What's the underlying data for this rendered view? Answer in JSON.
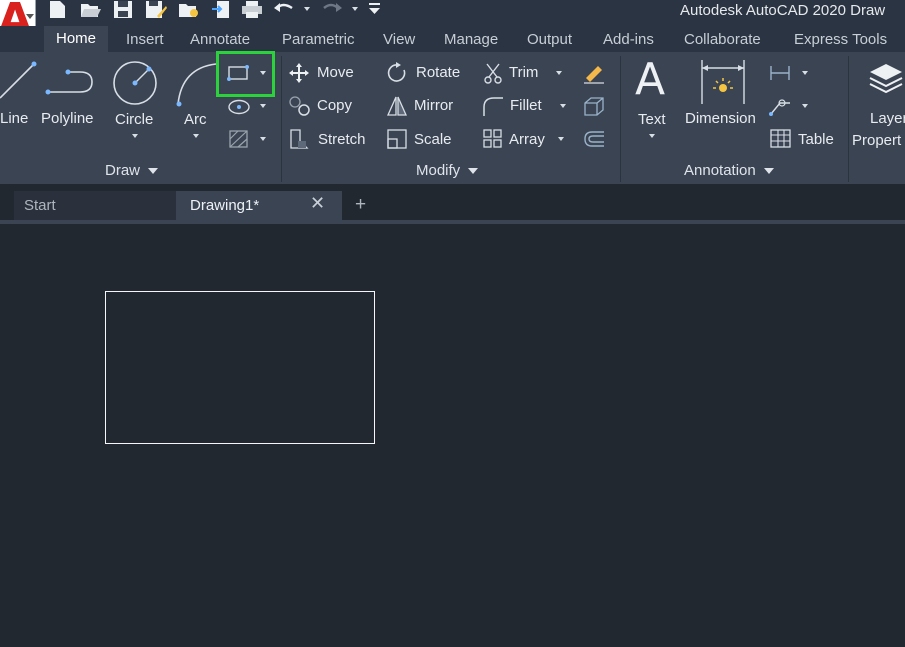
{
  "window": {
    "title": "Autodesk AutoCAD 2020  Draw"
  },
  "app_menu": {
    "logo_letter": "A"
  },
  "quick_access": [
    "new-icon",
    "open-icon",
    "save-icon",
    "save-as-icon",
    "open-from-web-icon",
    "save-to-web-icon",
    "plot-icon",
    "undo-icon",
    "redo-icon",
    "customize-icon"
  ],
  "ribbon_tabs": [
    {
      "label": "Home",
      "active": true
    },
    {
      "label": "Insert"
    },
    {
      "label": "Annotate"
    },
    {
      "label": "Parametric"
    },
    {
      "label": "View"
    },
    {
      "label": "Manage"
    },
    {
      "label": "Output"
    },
    {
      "label": "Add-ins"
    },
    {
      "label": "Collaborate"
    },
    {
      "label": "Express Tools"
    }
  ],
  "draw_panel": {
    "title": "Draw",
    "tools": {
      "line": "Line",
      "polyline": "Polyline",
      "circle": "Circle",
      "arc": "Arc"
    },
    "highlighted_tool": "rectangle",
    "highlight_color": "#2bd23c"
  },
  "modify_panel": {
    "title": "Modify",
    "tools": {
      "move": "Move",
      "rotate": "Rotate",
      "trim": "Trim",
      "copy": "Copy",
      "mirror": "Mirror",
      "fillet": "Fillet",
      "stretch": "Stretch",
      "scale": "Scale",
      "array": "Array"
    }
  },
  "annotation_panel": {
    "title": "Annotation",
    "tools": {
      "text": "Text",
      "dimension": "Dimension",
      "table": "Table"
    }
  },
  "layers_panel": {
    "layer_properties": "Layer\nPropert"
  },
  "document_tabs": [
    {
      "label": "Start"
    },
    {
      "label": "Drawing1*",
      "active": true
    }
  ],
  "colors": {
    "ribbon_bg": "#3b4453",
    "title_bg": "#2b3442",
    "canvas_bg": "#212830"
  }
}
